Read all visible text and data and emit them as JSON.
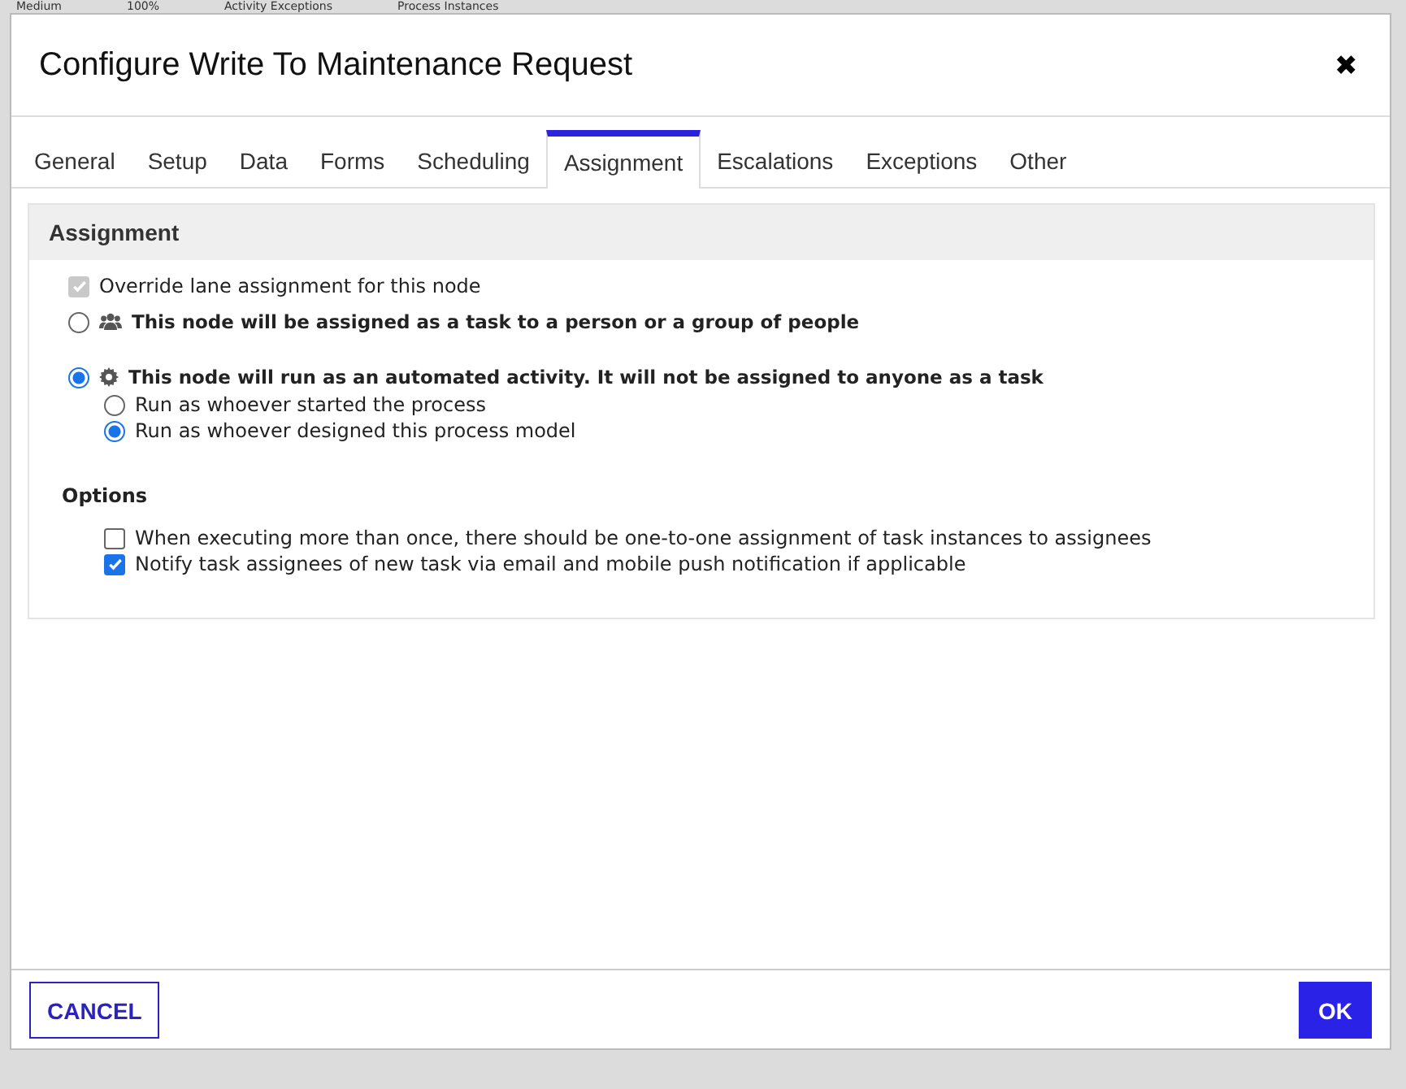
{
  "backdrop_toolbar": {
    "items": [
      "Medium",
      "100%",
      "Activity Exceptions",
      "Process Instances"
    ]
  },
  "dialog": {
    "title": "Configure Write To Maintenance Request",
    "close": "✖"
  },
  "tabs": [
    {
      "label": "General",
      "selected": false
    },
    {
      "label": "Setup",
      "selected": false
    },
    {
      "label": "Data",
      "selected": false
    },
    {
      "label": "Forms",
      "selected": false
    },
    {
      "label": "Scheduling",
      "selected": false
    },
    {
      "label": "Assignment",
      "selected": true
    },
    {
      "label": "Escalations",
      "selected": false
    },
    {
      "label": "Exceptions",
      "selected": false
    },
    {
      "label": "Other",
      "selected": false
    }
  ],
  "section": {
    "title": "Assignment",
    "override": {
      "label": "Override lane assignment for this node",
      "checked": true,
      "disabled": true
    },
    "modes": [
      {
        "kind": "people",
        "label": "This node will be assigned as a task to a person or a group of people",
        "selected": false
      },
      {
        "kind": "gear",
        "label": "This node will run as an automated activity. It will not be assigned to anyone as a task",
        "selected": true,
        "children": [
          {
            "label": "Run as whoever started the process",
            "selected": false
          },
          {
            "label": "Run as whoever designed this process model",
            "selected": true
          }
        ]
      }
    ],
    "options_title": "Options",
    "options": [
      {
        "label": "When executing more than once, there should be one-to-one assignment of task instances to assignees",
        "checked": false
      },
      {
        "label": "Notify task assignees of new task via email and mobile push notification if applicable",
        "checked": true
      }
    ]
  },
  "buttons": [
    {
      "kind": "secondary",
      "label": "CANCEL"
    },
    {
      "kind": "primary",
      "label": "OK"
    }
  ]
}
